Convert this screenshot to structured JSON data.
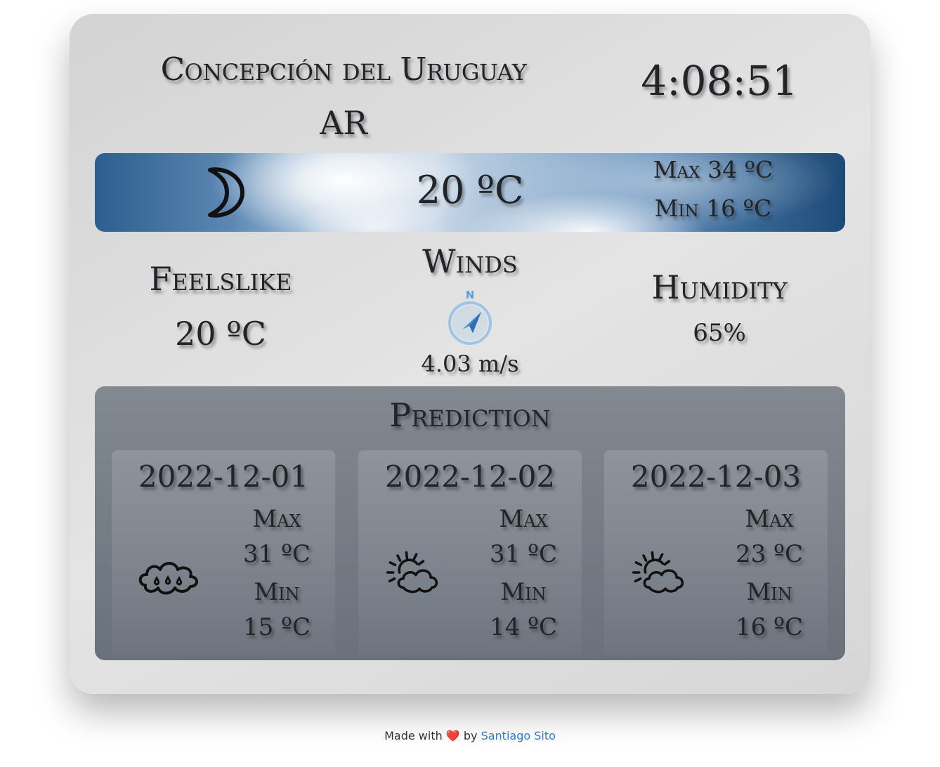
{
  "location": {
    "city": "Concepción del Uruguay",
    "country": "AR"
  },
  "clock": "4:08:51",
  "current": {
    "icon": "moon-icon",
    "temp": "20 ºC",
    "max_label": "Max 34 ºC",
    "min_label": "Min 16 ºC"
  },
  "feelslike": {
    "label": "Feelslike",
    "value": "20 ºC"
  },
  "winds": {
    "label": "Winds",
    "compass_letter": "N",
    "value": "4.03 m/s"
  },
  "humidity": {
    "label": "Humidity",
    "value": "65%"
  },
  "prediction": {
    "title": "Prediction",
    "days": [
      {
        "date": "2022-12-01",
        "icon": "rain-cloud-icon",
        "max_label": "Max",
        "max": "31 ºC",
        "min_label": "Min",
        "min": "15 ºC"
      },
      {
        "date": "2022-12-02",
        "icon": "partly-cloudy-icon",
        "max_label": "Max",
        "max": "31 ºC",
        "min_label": "Min",
        "min": "14 ºC"
      },
      {
        "date": "2022-12-03",
        "icon": "partly-cloudy-icon",
        "max_label": "Max",
        "max": "23 ºC",
        "min_label": "Min",
        "min": "16 ºC"
      }
    ]
  },
  "footer": {
    "made_with": "Made with",
    "heart": "❤️",
    "by": "by",
    "author": "Santiago Sito"
  },
  "colors": {
    "text": "#222428",
    "link": "#2f7bd8",
    "heart": "#e0242e",
    "compass": "#5c9fd8"
  }
}
